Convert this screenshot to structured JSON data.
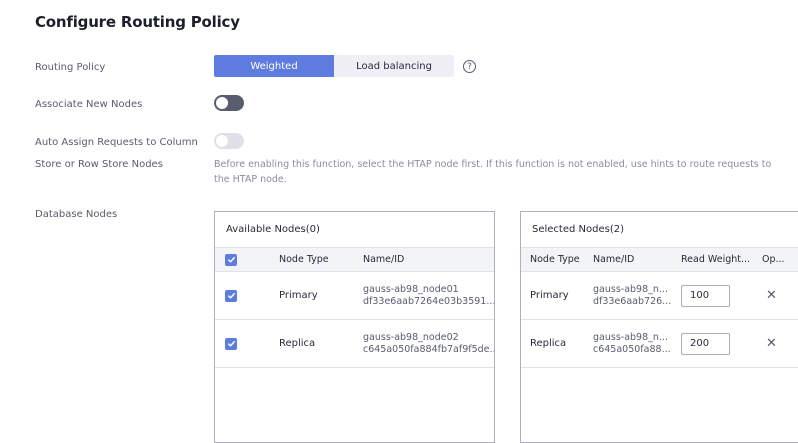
{
  "title": "Configure Routing Policy",
  "routing_policy": {
    "label": "Routing Policy",
    "options": [
      "Weighted",
      "Load balancing"
    ],
    "selected": "Weighted"
  },
  "associate_new_nodes": {
    "label": "Associate New Nodes",
    "enabled": false
  },
  "auto_assign": {
    "label_line1": "Auto Assign Requests to Column",
    "label_line2": "Store or Row Store Nodes",
    "enabled": false,
    "disabled": true,
    "hint": "Before enabling this function, select the HTAP node first. If this function is not enabled, use hints to route requests to the HTAP node."
  },
  "database_nodes": {
    "label": "Database Nodes",
    "available": {
      "title": "Available Nodes(0)",
      "columns": [
        "Node Type",
        "Name/ID"
      ],
      "rows": [
        {
          "type": "Primary",
          "name": "gauss-ab98_node01",
          "id": "df33e6aab7264e03b3591...",
          "checked": true
        },
        {
          "type": "Replica",
          "name": "gauss-ab98_node02",
          "id": "c645a050fa884fb7af9f5de...",
          "checked": true
        }
      ]
    },
    "selected": {
      "title": "Selected Nodes(2)",
      "columns": [
        "Node Type",
        "Name/ID",
        "Read Weight...",
        "Op..."
      ],
      "rows": [
        {
          "type": "Primary",
          "name": "gauss-ab98_n...",
          "id": "df33e6aab726...",
          "weight": "100"
        },
        {
          "type": "Replica",
          "name": "gauss-ab98_n...",
          "id": "c645a050fa88...",
          "weight": "200"
        }
      ]
    }
  },
  "colors": {
    "accent": "#5e7ce0",
    "text": "#252b3a",
    "muted": "#8a8e99"
  },
  "icons": {
    "help": "help-circle-icon",
    "remove": "close-icon",
    "check": "check-icon"
  }
}
